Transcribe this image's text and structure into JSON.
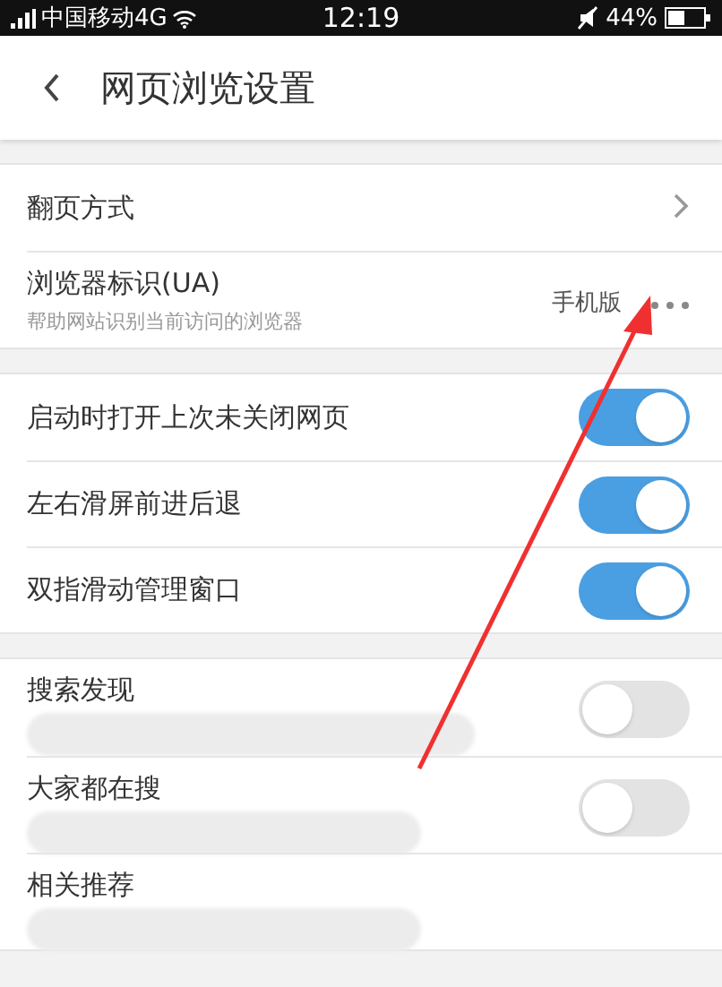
{
  "status_bar": {
    "carrier": "中国移动4G",
    "time": "12:19",
    "battery": "44%"
  },
  "header": {
    "title": "网页浏览设置"
  },
  "sections": [
    {
      "rows": [
        {
          "kind": "link",
          "title": "翻页方式"
        },
        {
          "kind": "value",
          "title": "浏览器标识(UA)",
          "subtitle": "帮助网站识别当前访问的浏览器",
          "value": "手机版"
        }
      ]
    },
    {
      "rows": [
        {
          "kind": "toggle",
          "title": "启动时打开上次未关闭网页",
          "on": true
        },
        {
          "kind": "toggle",
          "title": "左右滑屏前进后退",
          "on": true
        },
        {
          "kind": "toggle",
          "title": "双指滑动管理窗口",
          "on": true
        }
      ]
    },
    {
      "rows": [
        {
          "kind": "toggle",
          "title": "搜索发现",
          "on": false,
          "redacted": true
        },
        {
          "kind": "toggle",
          "title": "大家都在搜",
          "on": false,
          "redacted": true
        },
        {
          "kind": "plain",
          "title": "相关推荐",
          "redacted": true
        }
      ]
    }
  ],
  "annotation": {
    "kind": "arrow"
  }
}
